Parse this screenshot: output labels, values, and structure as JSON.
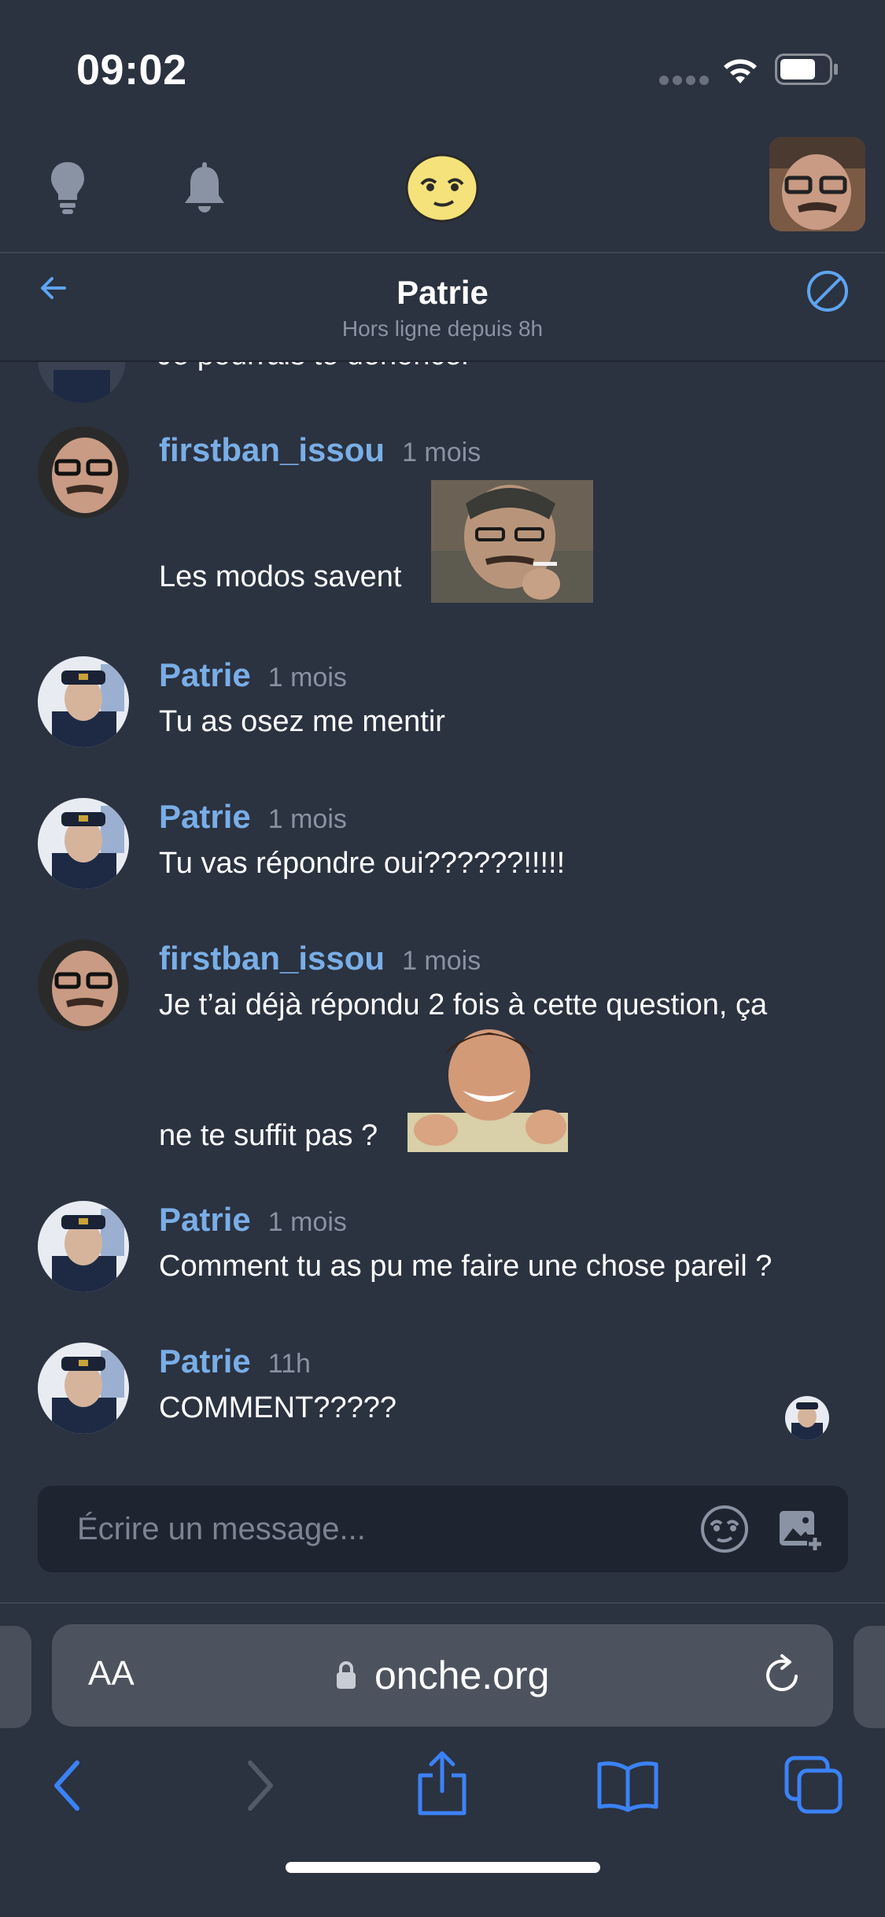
{
  "status_bar": {
    "time": "09:02"
  },
  "top_nav": {
    "icons": [
      "lightbulb-icon",
      "bell-icon",
      "smiley-logo-icon",
      "profile-avatar"
    ]
  },
  "conversation": {
    "title": "Patrie",
    "subtitle": "Hors ligne depuis 8h"
  },
  "messages": {
    "partial_top_text": "Je pourrais te dénoncer",
    "items": [
      {
        "author": "firstban_issou",
        "time": "1 mois",
        "text": "Les modos savent",
        "sticker": "smoking-man-sticker"
      },
      {
        "author": "Patrie",
        "time": "1 mois",
        "text": "Tu as osez me mentir"
      },
      {
        "author": "Patrie",
        "time": "1 mois",
        "text": "Tu vas répondre oui??????!!!!!"
      },
      {
        "author": "firstban_issou",
        "time": "1 mois",
        "text": "Je t’ai déjà répondu 2 fois à cette question, ça",
        "text2": "ne te suffit pas ?",
        "sticker": "laughing-man-sticker"
      },
      {
        "author": "Patrie",
        "time": "1 mois",
        "text": "Comment tu as pu me faire une chose pareil ?"
      },
      {
        "author": "Patrie",
        "time": "11h",
        "text": "COMMENT?????"
      }
    ]
  },
  "composer": {
    "placeholder": "Écrire un message..."
  },
  "browser": {
    "text_size_label": "AA",
    "url": "onche.org"
  },
  "colors": {
    "background": "#2b3240",
    "accent_name": "#79aee6",
    "composer_bg": "#1f2530",
    "ios_blue": "#3b82f6"
  }
}
